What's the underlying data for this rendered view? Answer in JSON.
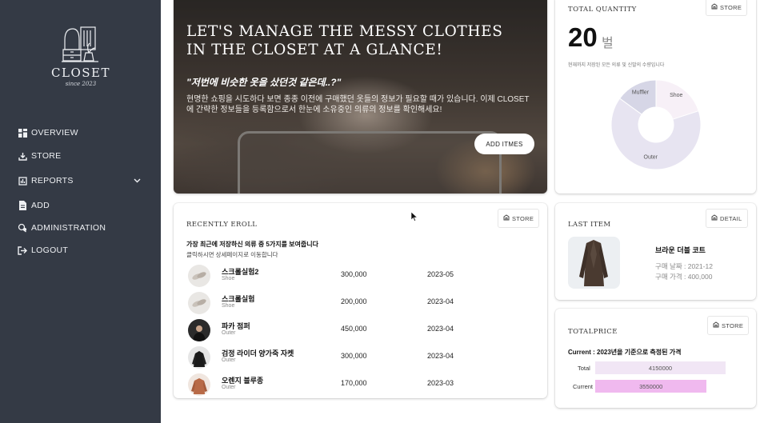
{
  "sidebar": {
    "logo_text": "CLOSET",
    "logo_sub": "since 2023",
    "items": [
      {
        "label": "OVERVIEW",
        "icon": "grid-icon"
      },
      {
        "label": "STORE",
        "icon": "download-icon"
      },
      {
        "label": "REPORTS",
        "icon": "report-icon"
      },
      {
        "label": "ADD",
        "icon": "file-icon"
      },
      {
        "label": "ADMINISTRATION",
        "icon": "admin-icon"
      },
      {
        "label": "LOGOUT",
        "icon": "logout-icon"
      }
    ]
  },
  "hero": {
    "title": "LET'S MANAGE THE MESSY CLOTHES IN THE CLOSET AT A GLANCE!",
    "quote": "\"저번에 비슷한 옷을 샀던것 같은데..?\"",
    "description": "현명한 쇼핑을 시도하다 보면 종종 이전에 구매했던 옷들의 정보가 필요할 때가 있습니다. 이제 CLOSET 에 간략한 정보들을 등록함으로서 한눈에 소유중인 의류의 정보를 확인해세요!",
    "button": "ADD ITMES"
  },
  "total_quantity": {
    "title": "TOTAL QUANTITY",
    "store_button": "STORE",
    "count": "20",
    "unit": "벌",
    "note": "현재까지 저장된 모든 의류 및 신발의 수량입니다"
  },
  "chart_data": {
    "type": "pie",
    "labels": [
      "Shoe",
      "Outer",
      "Muffler"
    ],
    "values": [
      4,
      13,
      3
    ],
    "colors": [
      "#f7f0f7",
      "#e7e4f1",
      "#d6d6e6"
    ]
  },
  "recent": {
    "title": "RECENTLY EROLL",
    "store_button": "STORE",
    "heading": "가장 최근에 저장하신 의류 중 5가지를 보여줍니다",
    "subheading": "클릭하시면 상세페이지로 이동합니다",
    "rows": [
      {
        "name": "스크롤실험2",
        "category": "Shoe",
        "price": "300,000",
        "date": "2023-05"
      },
      {
        "name": "스크롤실험",
        "category": "Shoe",
        "price": "200,000",
        "date": "2023-04"
      },
      {
        "name": "파카 점퍼",
        "category": "Outer",
        "price": "450,000",
        "date": "2023-04"
      },
      {
        "name": "검정 라이더 양가죽 자켓",
        "category": "Outer",
        "price": "300,000",
        "date": "2023-04"
      },
      {
        "name": "오렌지 블루종",
        "category": "Outer",
        "price": "170,000",
        "date": "2023-03"
      }
    ]
  },
  "last_item": {
    "title": "LAST ITEM",
    "detail_button": "DETAIL",
    "name": "브라운 더블 코트",
    "date": "구매 날짜 : 2021-12",
    "price": "구매 가격 : 400,000"
  },
  "total_price": {
    "title": "TOTALPRICE",
    "store_button": "STORE",
    "heading": "Current : 2023년을 기준으로 측정된 가격",
    "bars": [
      {
        "label": "Total",
        "value": "4150000",
        "amount": 4150000,
        "color": "#f1e6f5"
      },
      {
        "label": "Current",
        "value": "3550000",
        "amount": 3550000,
        "color": "#f0b9ef"
      }
    ]
  }
}
